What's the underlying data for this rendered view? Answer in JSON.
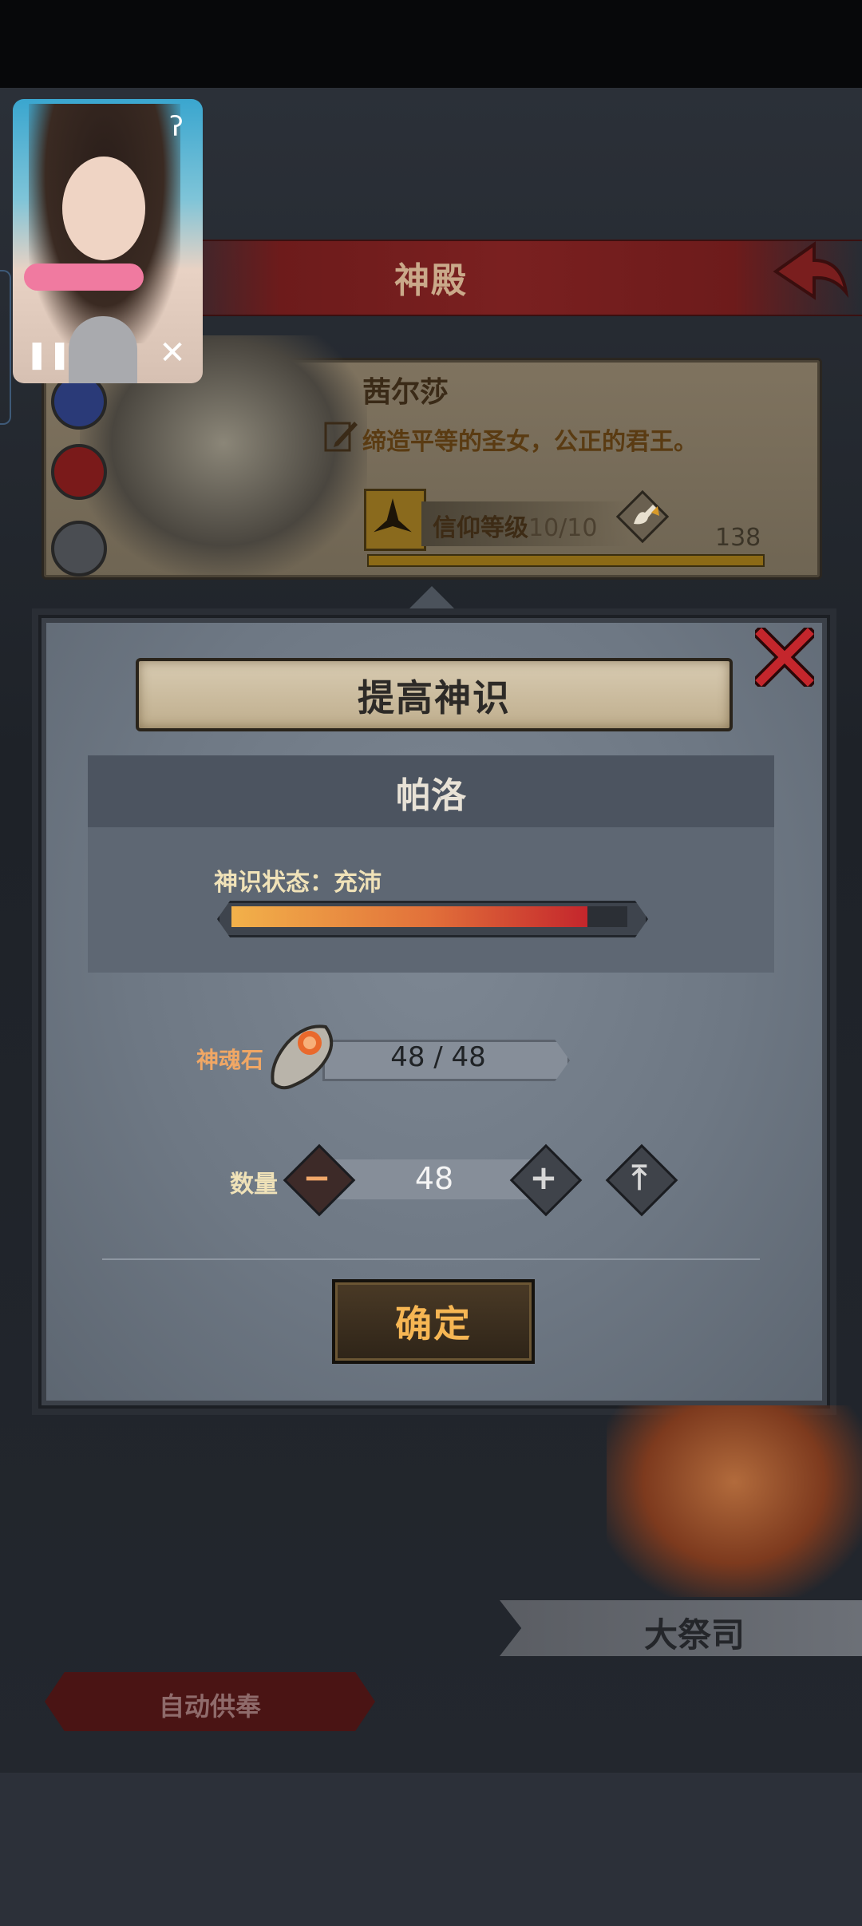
{
  "background": {
    "header": {
      "title": "神殿"
    },
    "god_card": {
      "name": "茜尔莎",
      "description": "缔造平等的圣女，公正的君王。",
      "faith_label": "信仰等级",
      "faith_level": "10/10",
      "faith_points": "138"
    },
    "priest": {
      "name": "大祭司"
    },
    "auto_offer_button": "自动供奉"
  },
  "dialog": {
    "title": "提高神识",
    "deity_name": "帕洛",
    "state_label": "神识状态：充沛",
    "state_level": 0.9,
    "stone_label": "神魂石",
    "stone_count": "48 / 48",
    "quantity_label": "数量",
    "quantity_value": "48",
    "minus_glyph": "−",
    "plus_glyph": "+",
    "max_glyph": "⤒",
    "confirm_label": "确定"
  },
  "overlay": {
    "pause_glyph": "❚❚",
    "close_glyph": "✕",
    "ear_glyph": "ʔ"
  },
  "colors": {
    "accent_red": "#c4262c",
    "confirm_text": "#f6b653",
    "stone_label": "#f0a765"
  }
}
